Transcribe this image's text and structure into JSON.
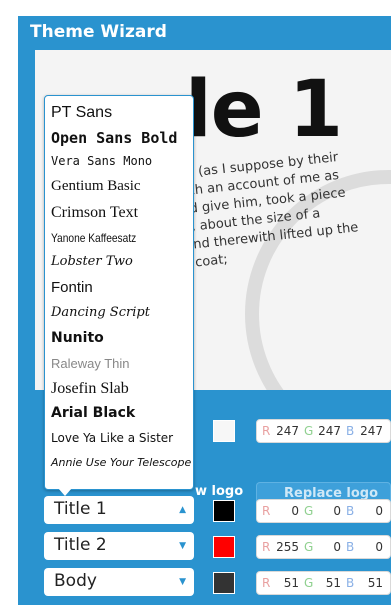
{
  "window": {
    "title": "Theme Wizard"
  },
  "preview": {
    "title_text": "le 1",
    "body_text": "g (as I suppose by their\nch an account of me as\nd give him, took a piece\n, about the size of a\nnd therewith lifted up the\ncoat;"
  },
  "font_dropdown": {
    "options": [
      "PT Sans",
      "Open Sans Bold",
      "Vera Sans Mono",
      "Gentium Basic",
      "Crimson Text",
      "Yanone Kaffeesatz",
      "Lobster Two",
      "Fontin",
      "Dancing Script",
      "Nunito",
      "Raleway Thin",
      "Josefin Slab",
      "Arial Black",
      "Love Ya Like a Sister",
      "Annie Use Your Telescope"
    ]
  },
  "logo": {
    "left_label": "w logo",
    "replace_label": "Replace logo"
  },
  "colors": {
    "accent": "#2a93cf",
    "background_row": {
      "r": "247",
      "g": "247",
      "b": "247",
      "swatch": "#f7f7f7"
    },
    "title1_row": {
      "r": "0",
      "g": "0",
      "b": "0",
      "swatch": "#000000"
    },
    "title2_row": {
      "r": "255",
      "g": "0",
      "b": "0",
      "swatch": "#ff0000"
    },
    "body_row": {
      "r": "51",
      "g": "51",
      "b": "51",
      "swatch": "#333333"
    }
  },
  "text_styles": {
    "title1": "Title 1",
    "title2": "Title 2",
    "body": "Body"
  },
  "labels": {
    "r": "R",
    "g": "G",
    "b": "B"
  },
  "icons": {
    "select_arrow": "chevron-down-icon"
  }
}
